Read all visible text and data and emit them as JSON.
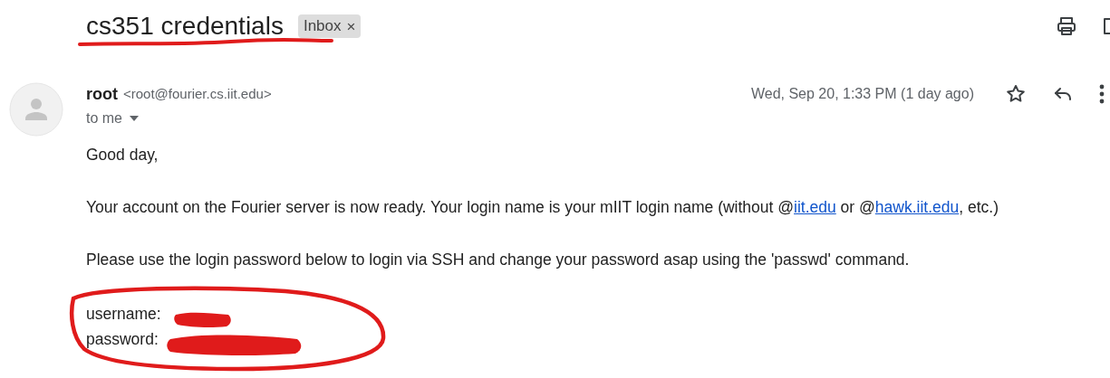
{
  "subject": "cs351 credentials",
  "label": {
    "text": "Inbox",
    "close": "×"
  },
  "sender": {
    "name": "root",
    "email": "<root@fourier.cs.iit.edu>",
    "recipient": "to me",
    "date": "Wed, Sep 20, 1:33 PM (1 day ago)",
    "starred": false
  },
  "body": [
    {
      "kind": "text",
      "text": "Good day,"
    },
    {
      "kind": "rich",
      "parts": [
        {
          "kind": "text",
          "text": "Your account on the Fourier server is now ready. Your login name is your mIIT login name (without @"
        },
        {
          "kind": "link",
          "text": "iit.edu"
        },
        {
          "kind": "text",
          "text": " or @"
        },
        {
          "kind": "link",
          "text": "hawk.iit.edu"
        },
        {
          "kind": "text",
          "text": ", etc.)"
        }
      ]
    },
    {
      "kind": "text",
      "text": "Please use the login password below to login via SSH and change your password asap using the 'passwd' command."
    },
    {
      "kind": "credentials",
      "lines": [
        "username:",
        "password:"
      ]
    }
  ]
}
